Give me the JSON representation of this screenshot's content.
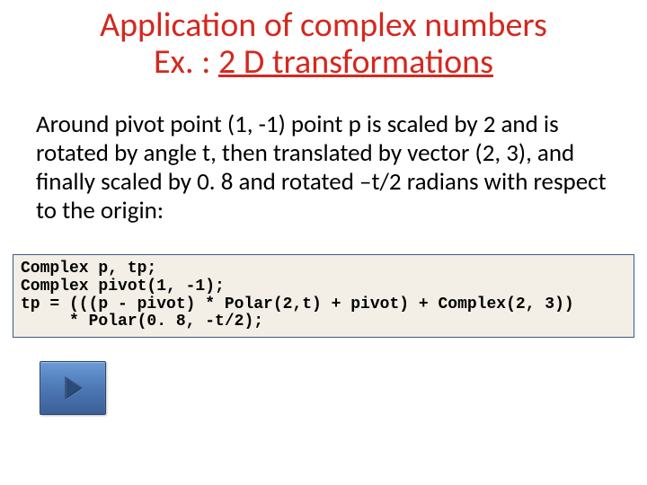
{
  "title": {
    "line1": "Application of complex numbers",
    "line2_prefix": "Ex. : ",
    "line2_underlined": "2 D transformations"
  },
  "body": {
    "text": "Around pivot point (1, -1)  point p is scaled by 2 and is rotated by angle t, then translated by vector (2, 3), and finally scaled by 0. 8 and rotated –t/2 radians with respect to the origin:"
  },
  "code": {
    "text": "Complex p, tp;\nComplex pivot(1, -1);\ntp = (((p - pivot) * Polar(2,t) + pivot) + Complex(2, 3))\n     * Polar(0. 8, -t/2);"
  },
  "button": {
    "icon_name": "forward-right"
  }
}
